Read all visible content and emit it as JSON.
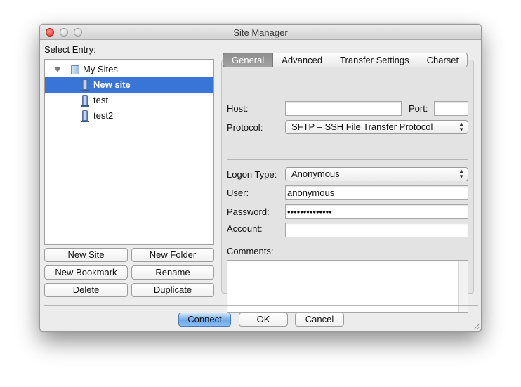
{
  "window": {
    "title": "Site Manager"
  },
  "left_panel": {
    "select_entry_label": "Select Entry:",
    "tree": [
      {
        "label": "My Sites",
        "type": "folder",
        "expanded": true,
        "selected": false
      },
      {
        "label": "New site",
        "type": "site",
        "selected": true
      },
      {
        "label": "test",
        "type": "site",
        "selected": false
      },
      {
        "label": "test2",
        "type": "site",
        "selected": false
      }
    ],
    "buttons": {
      "new_site": "New Site",
      "new_folder": "New Folder",
      "new_bookmark": "New Bookmark",
      "rename": "Rename",
      "delete": "Delete",
      "duplicate": "Duplicate"
    }
  },
  "tabs": [
    {
      "label": "General",
      "active": true
    },
    {
      "label": "Advanced",
      "active": false
    },
    {
      "label": "Transfer Settings",
      "active": false
    },
    {
      "label": "Charset",
      "active": false
    }
  ],
  "general": {
    "host_label": "Host:",
    "host_value": "",
    "port_label": "Port:",
    "port_value": "",
    "protocol_label": "Protocol:",
    "protocol_value": "SFTP – SSH File Transfer Protocol",
    "logon_type_label": "Logon Type:",
    "logon_type_value": "Anonymous",
    "user_label": "User:",
    "user_value": "anonymous",
    "password_label": "Password:",
    "password_value": "••••••••••••••",
    "account_label": "Account:",
    "account_value": "",
    "comments_label": "Comments:",
    "comments_value": ""
  },
  "footer": {
    "connect": "Connect",
    "ok": "OK",
    "cancel": "Cancel"
  },
  "colors": {
    "selection": "#3875d7",
    "default_button": "#6fa9ea",
    "active_tab": "#8d8d8d"
  }
}
